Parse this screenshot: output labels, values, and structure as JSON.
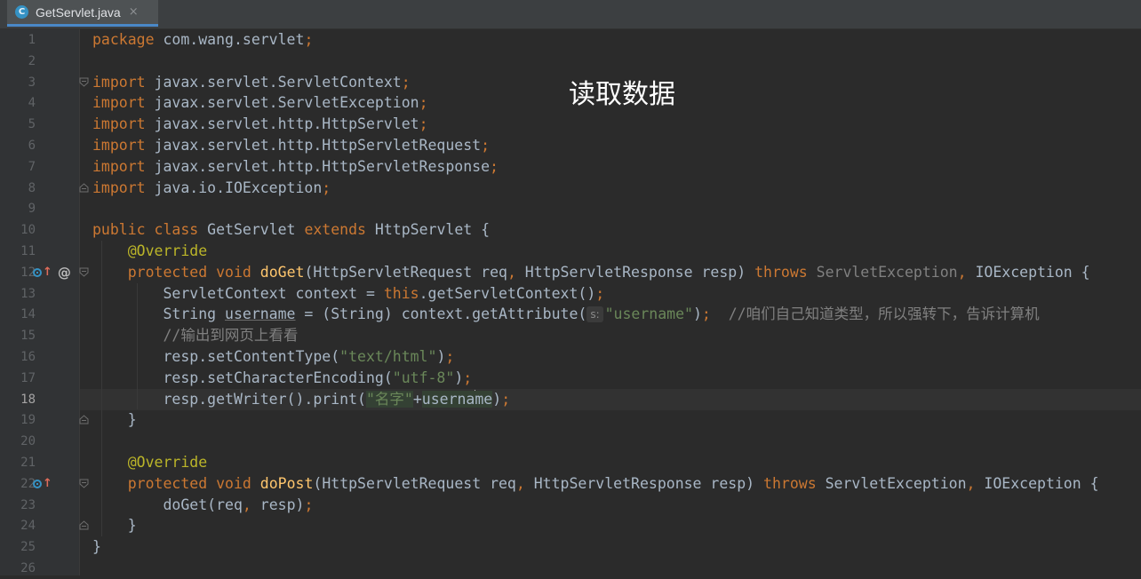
{
  "tab": {
    "label": "GetServlet.java",
    "icon": "class-icon",
    "icon_letter": "C",
    "close": "×"
  },
  "overlay_title": "读取数据",
  "current_line": 18,
  "gutter_icons": [
    {
      "line": 12,
      "icons": [
        "overrides-method-icon",
        "at-icon"
      ]
    },
    {
      "line": 22,
      "icons": [
        "overrides-method-icon"
      ]
    }
  ],
  "inline_hint": "s:",
  "code_lines": [
    "package com.wang.servlet;",
    "",
    "import javax.servlet.ServletContext;",
    "import javax.servlet.ServletException;",
    "import javax.servlet.http.HttpServlet;",
    "import javax.servlet.http.HttpServletRequest;",
    "import javax.servlet.http.HttpServletResponse;",
    "import java.io.IOException;",
    "",
    "public class GetServlet extends HttpServlet {",
    "    @Override",
    "    protected void doGet(HttpServletRequest req, HttpServletResponse resp) throws ServletException, IOException {",
    "        ServletContext context = this.getServletContext();",
    "        String username = (String) context.getAttribute( \"username\");  //咱们自己知道类型，所以强转下，告诉计算机",
    "        //输出到网页上看看",
    "        resp.setContentType(\"text/html\");",
    "        resp.setCharacterEncoding(\"utf-8\");",
    "        resp.getWriter().print(\"名字\"+username);",
    "    }",
    "",
    "    @Override",
    "    protected void doPost(HttpServletRequest req, HttpServletResponse resp) throws ServletException, IOException {",
    "        doGet(req, resp);",
    "    }",
    "}",
    ""
  ],
  "colors": {
    "background": "#2b2b2b",
    "keyword": "#cc7832",
    "method": "#ffc66d",
    "string": "#6a8759",
    "annotation": "#bbb529",
    "comment": "#808080",
    "text": "#a9b7c6"
  }
}
